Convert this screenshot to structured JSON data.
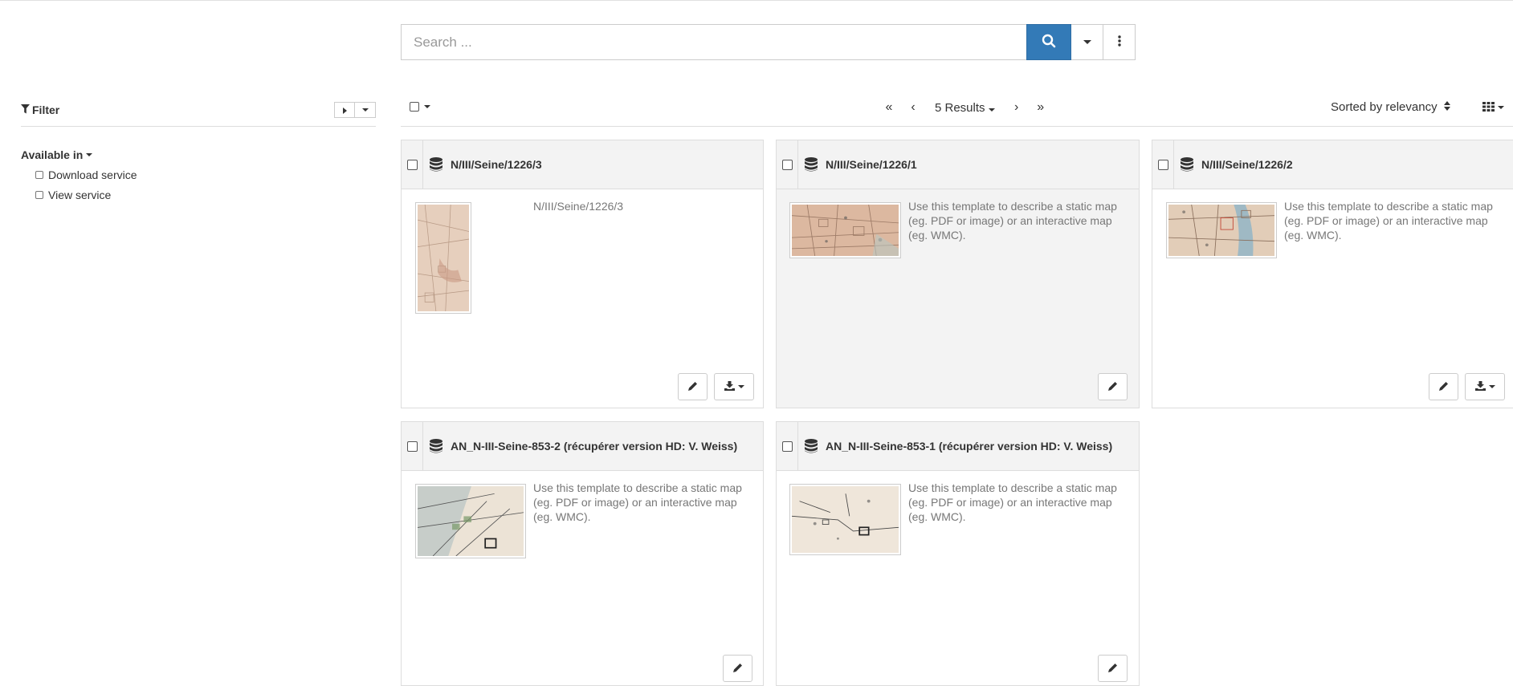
{
  "search": {
    "placeholder": "Search ..."
  },
  "filter": {
    "title": "Filter",
    "group_label": "Available in",
    "options": [
      {
        "label": "Download service"
      },
      {
        "label": "View service"
      }
    ]
  },
  "toolbar": {
    "first": "«",
    "prev": "‹",
    "results": "5 Results",
    "next": "›",
    "last": "»",
    "sort": "Sorted by relevancy"
  },
  "cards": [
    {
      "title": "N/III/Seine/1226/3",
      "description": "N/III/Seine/1226/3"
    },
    {
      "title": "N/III/Seine/1226/1",
      "description": "Use this template to describe a static map (eg. PDF or image) or an interactive map (eg. WMC)."
    },
    {
      "title": "N/III/Seine/1226/2",
      "description": "Use this template to describe a static map (eg. PDF or image) or an interactive map (eg. WMC)."
    },
    {
      "title": "AN_N-III-Seine-853-2 (récupérer version HD: V. Weiss)",
      "description": "Use this template to describe a static map (eg. PDF or image) or an interactive map (eg. WMC)."
    },
    {
      "title": "AN_N-III-Seine-853-1 (récupérer version HD: V. Weiss)",
      "description": "Use this template to describe a static map (eg. PDF or image) or an interactive map (eg. WMC)."
    }
  ],
  "icons": {
    "search": "search-icon",
    "filter": "filter-icon",
    "database": "database-icon",
    "edit": "pencil-icon",
    "download": "download-icon",
    "grid": "grid-icon",
    "more": "vertical-dots-icon"
  },
  "colors": {
    "primary": "#337ab7",
    "card_header": "#f3f3f3",
    "map_paper": "#e8d4c0"
  }
}
